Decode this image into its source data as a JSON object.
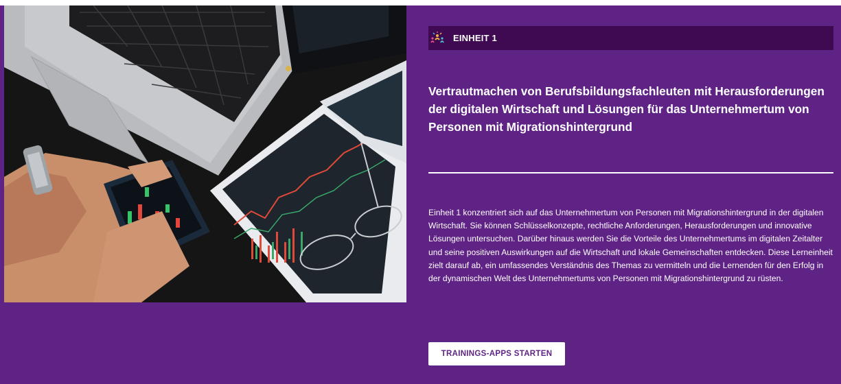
{
  "unit": {
    "label": "EINHEIT 1",
    "icon": "people-celebration-icon"
  },
  "headline": "Vertrautmachen von Berufsbildungsfachleuten mit Herausforderungen der digitalen Wirtschaft und Lösungen für das Unternehmertum von Personen mit Migrationshintergrund",
  "description": "Einheit 1 konzentriert sich auf das Unternehmertum von Personen mit Migrationshintergrund in der digitalen Wirtschaft. Sie können Schlüsselkonzepte, rechtliche Anforderungen, Herausforderungen und innovative Lösungen untersuchen. Darüber hinaus werden Sie die Vorteile des Unternehmertums im digitalen Zeitalter und seine positiven Auswirkungen auf die Wirtschaft und lokale Gemeinschaften entdecken. Diese Lerneinheit zielt darauf ab, ein umfassendes Verständnis des Themas zu vermitteln und die Lernenden für den Erfolg in der dynamischen Welt des Unternehmertums von Personen mit Migrationshintergrund zu rüsten.",
  "cta": {
    "label": "TRAININGS-APPS STARTEN"
  },
  "colors": {
    "panel": "#5f2386",
    "unit_bar": "#3f0a52",
    "text": "#ffffff",
    "button_text": "#5f2386"
  }
}
